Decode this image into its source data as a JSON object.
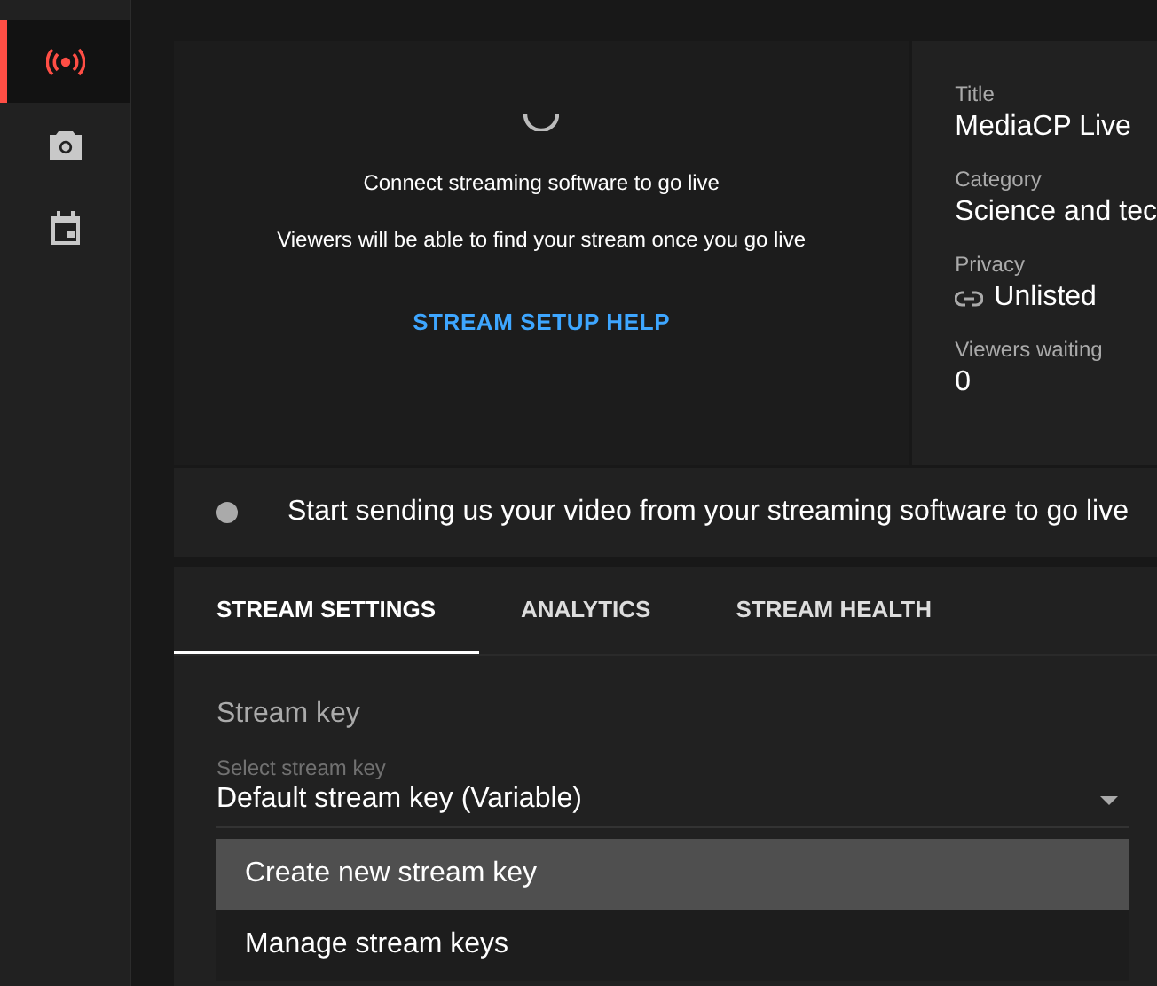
{
  "sidebar": {
    "items": [
      {
        "kind": "live",
        "selected": true
      },
      {
        "kind": "camera",
        "selected": false
      },
      {
        "kind": "calendar",
        "selected": false
      }
    ]
  },
  "preview": {
    "lines": [
      "Connect streaming software to go live",
      "Viewers will be able to find your stream once you go live"
    ],
    "help_link": "STREAM SETUP HELP"
  },
  "details": [
    {
      "label": "Title",
      "value": "MediaCP Live"
    },
    {
      "label": "Category",
      "value": "Science and tec"
    },
    {
      "label": "Privacy",
      "value": "Unlisted",
      "kind": "link"
    },
    {
      "label": "Viewers waiting",
      "value": "0"
    }
  ],
  "status": {
    "text": "Start sending us your video from your streaming software to go live"
  },
  "tabs": [
    {
      "label": "STREAM SETTINGS",
      "selected": true
    },
    {
      "label": "ANALYTICS",
      "selected": false
    },
    {
      "label": "STREAM HEALTH",
      "selected": false
    }
  ],
  "stream_key": {
    "heading": "Stream key",
    "select_label": "Select stream key",
    "value": "Default stream key (Variable)",
    "menu": [
      {
        "label": "Create new stream key",
        "selected": true
      },
      {
        "label": "Manage stream keys",
        "selected": false
      }
    ]
  }
}
